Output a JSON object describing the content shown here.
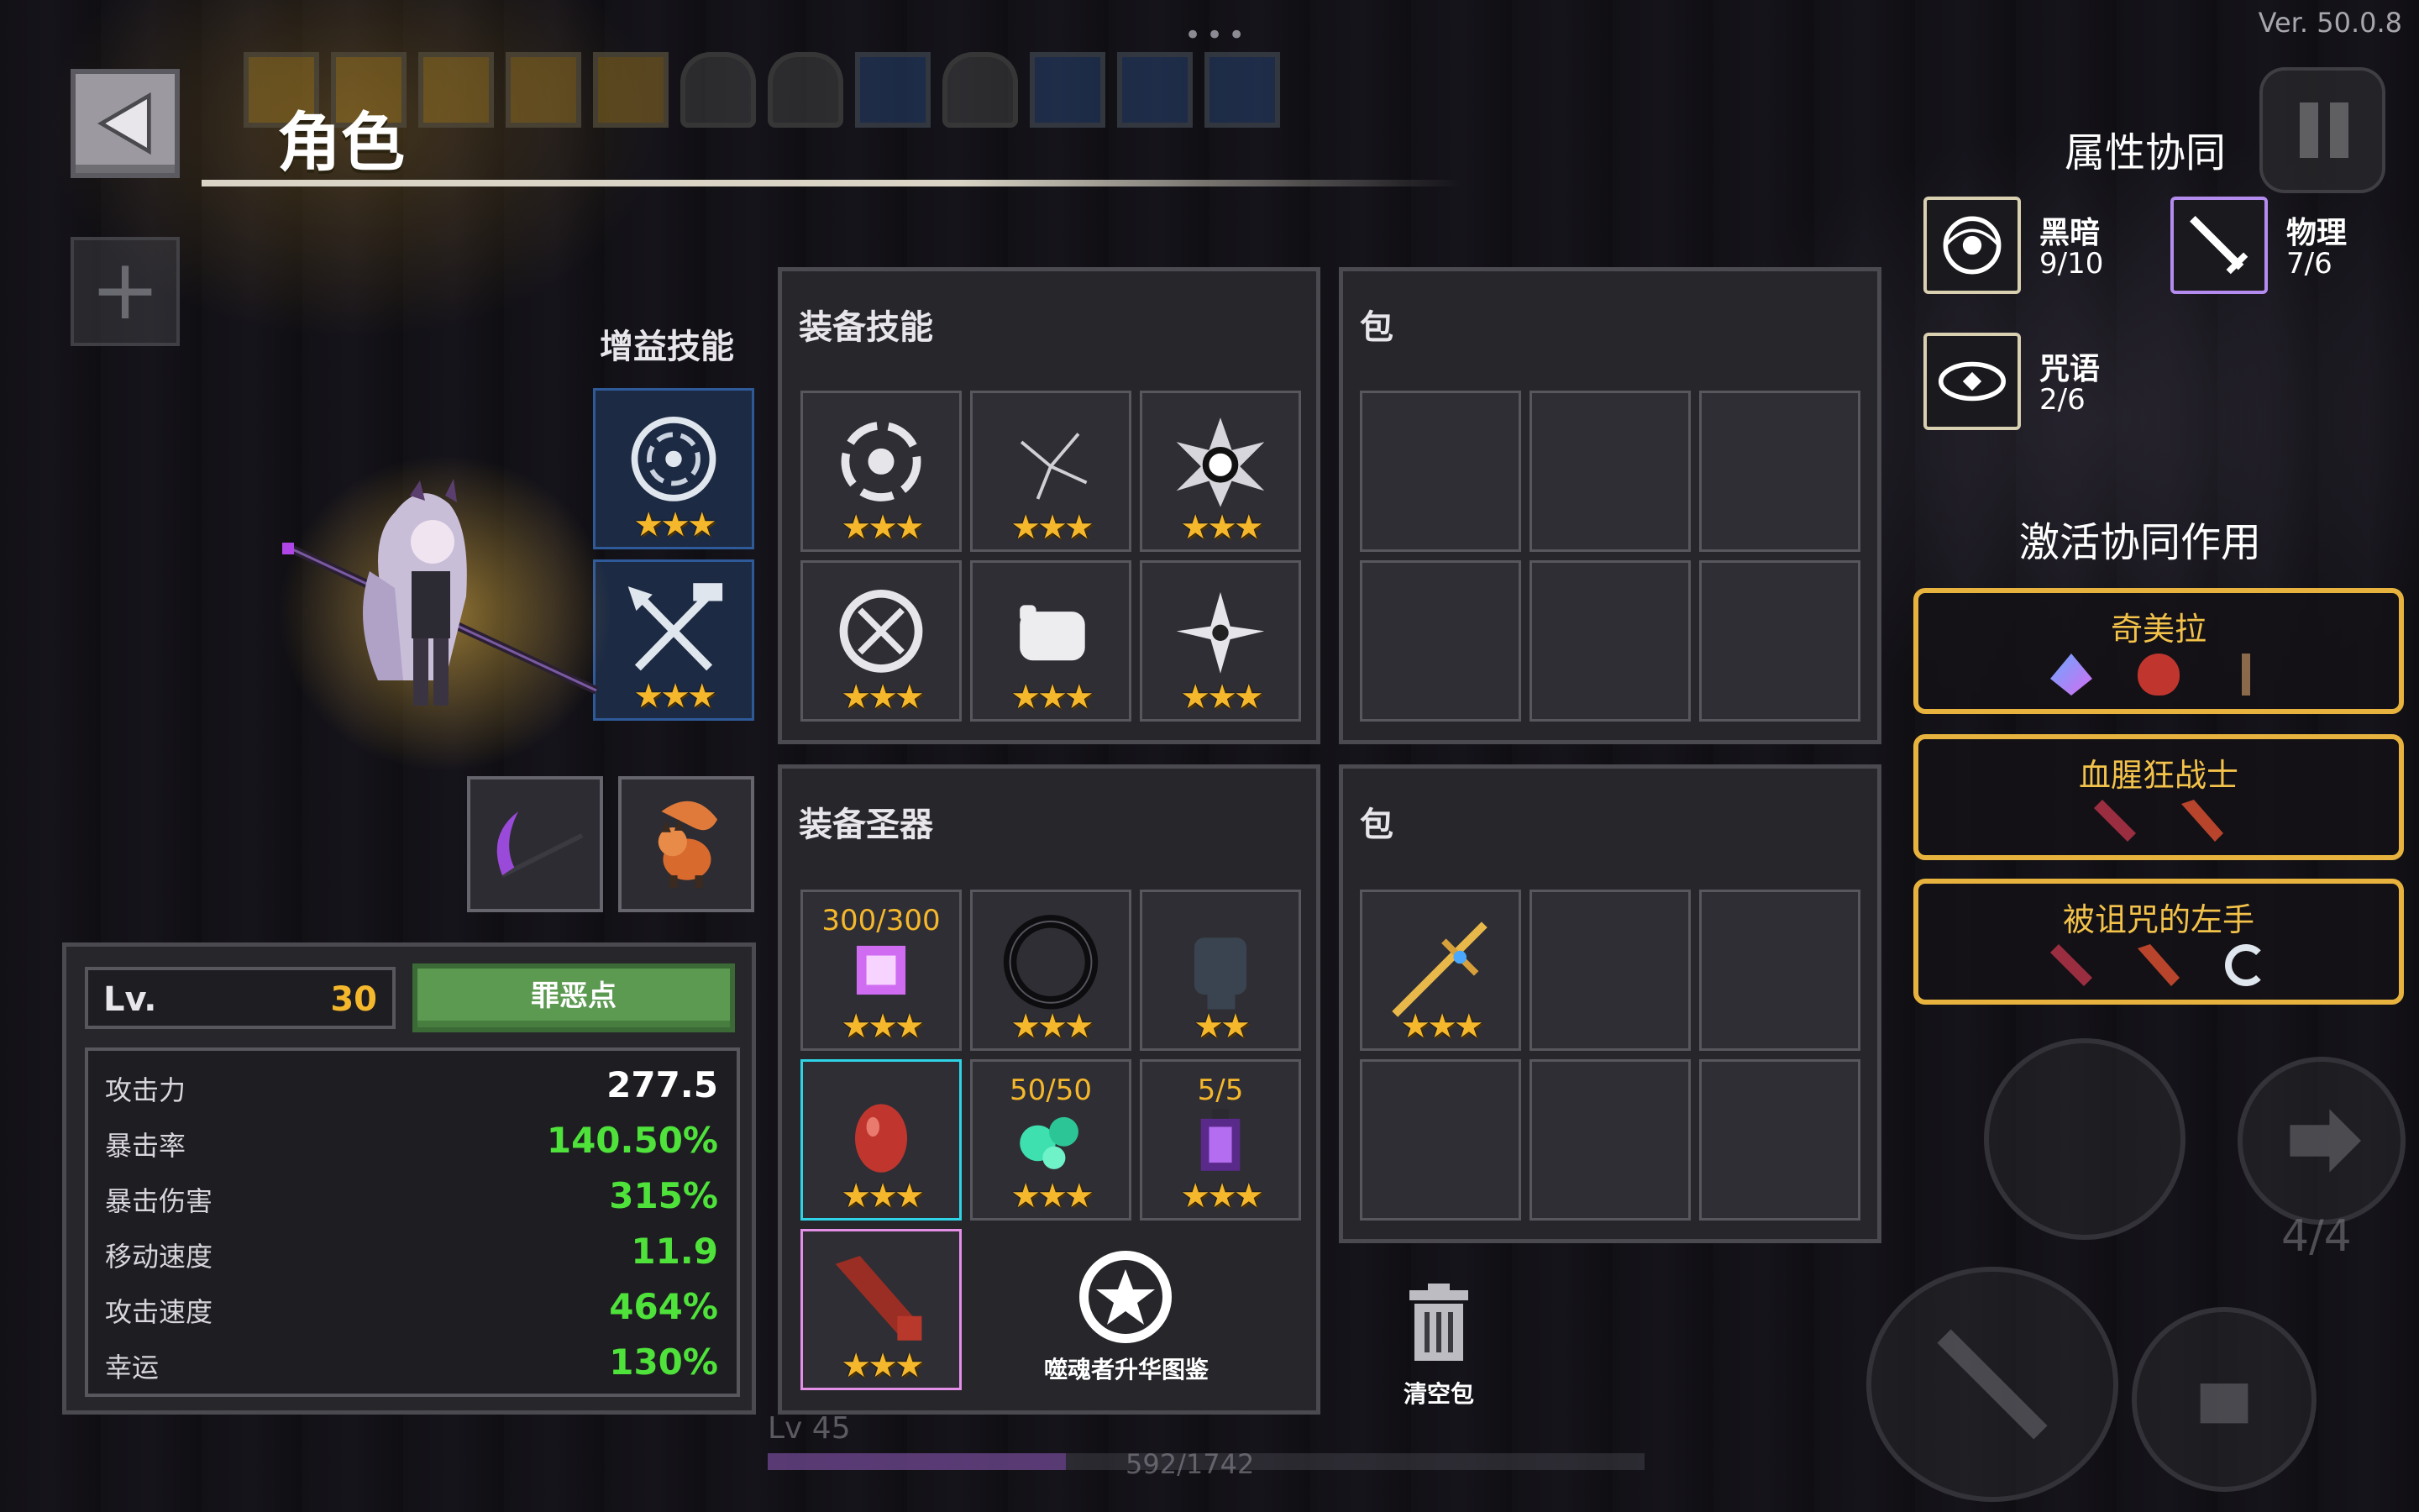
{
  "header": {
    "title": "角色",
    "version": "Ver. 50.0.8",
    "top_dots": "•••"
  },
  "buff_skills": {
    "title": "增益技能",
    "slots": [
      {
        "icon": "vortex-shield-icon",
        "stars": "★★★"
      },
      {
        "icon": "crossed-weapons-icon",
        "stars": "★★★"
      }
    ]
  },
  "equip_skills": {
    "title": "装备技能",
    "slots": [
      {
        "icon": "spiral-icon",
        "stars": "★★★"
      },
      {
        "icon": "crack-icon",
        "stars": "★★★"
      },
      {
        "icon": "eye-burst-icon",
        "stars": "★★★"
      },
      {
        "icon": "ring-blades-icon",
        "stars": "★★★"
      },
      {
        "icon": "fist-icon",
        "stars": "★★★"
      },
      {
        "icon": "shuriken-icon",
        "stars": "★★★"
      }
    ]
  },
  "bag_top": {
    "title": "包"
  },
  "equip_relics": {
    "title": "装备圣器",
    "slots": [
      {
        "icon": "purple-crystal-icon",
        "counter": "300/300",
        "stars": "★★★"
      },
      {
        "icon": "dark-ring-icon",
        "counter": "",
        "stars": "★★★"
      },
      {
        "icon": "dark-gauntlet-icon",
        "counter": "",
        "stars": "★★"
      },
      {
        "icon": "red-egg-icon",
        "counter": "",
        "stars": "★★★"
      },
      {
        "icon": "green-orbs-icon",
        "counter": "50/50",
        "stars": "★★★"
      },
      {
        "icon": "purple-lantern-icon",
        "counter": "5/5",
        "stars": "★★★"
      },
      {
        "icon": "red-arm-icon",
        "counter": "",
        "stars": "★★★"
      }
    ],
    "codex_label": "噬魂者升华图鉴"
  },
  "bag_bottom": {
    "title": "包",
    "item": {
      "icon": "golden-sword-icon",
      "stars": "★★★"
    }
  },
  "clear_bag": {
    "label": "清空包"
  },
  "character": {
    "weapon_icon": "scythe-icon",
    "pet_icon": "fox-pet-icon"
  },
  "stats": {
    "level_label": "Lv.",
    "level_value": "30",
    "sin_button": "罪恶点",
    "rows": [
      {
        "label": "攻击力",
        "value": "277.5"
      },
      {
        "label": "暴击率",
        "value": "140.50%"
      },
      {
        "label": "暴击伤害",
        "value": "315%"
      },
      {
        "label": "移动速度",
        "value": "11.9"
      },
      {
        "label": "攻击速度",
        "value": "464%"
      },
      {
        "label": "幸运",
        "value": "130%"
      }
    ]
  },
  "exp_bar": {
    "level": "Lv 45",
    "text": "592/1742",
    "fraction": 0.34
  },
  "synergy": {
    "title": "属性协同",
    "items": [
      {
        "name": "黑暗",
        "value": "9/10",
        "icon": "dark-eye-icon"
      },
      {
        "name": "物理",
        "value": "7/6",
        "icon": "sword-icon"
      },
      {
        "name": "咒语",
        "value": "2/6",
        "icon": "rune-eye-icon"
      }
    ],
    "active_title": "激活协同作用",
    "active": [
      {
        "name": "奇美拉",
        "icons": [
          "crystal-icon",
          "egg-icon",
          "lizard-icon"
        ]
      },
      {
        "name": "血腥狂战士",
        "icons": [
          "blade-icon",
          "arm-icon"
        ]
      },
      {
        "name": "被诅咒的左手",
        "icons": [
          "blade-icon",
          "arm-icon",
          "hook-icon"
        ]
      }
    ]
  },
  "hud": {
    "counter": "4/4"
  },
  "colors": {
    "accent_gold": "#f5b82c",
    "stat_green": "#4ee23a",
    "synergy_border": "#e7b33e",
    "panel": "#27262b"
  }
}
